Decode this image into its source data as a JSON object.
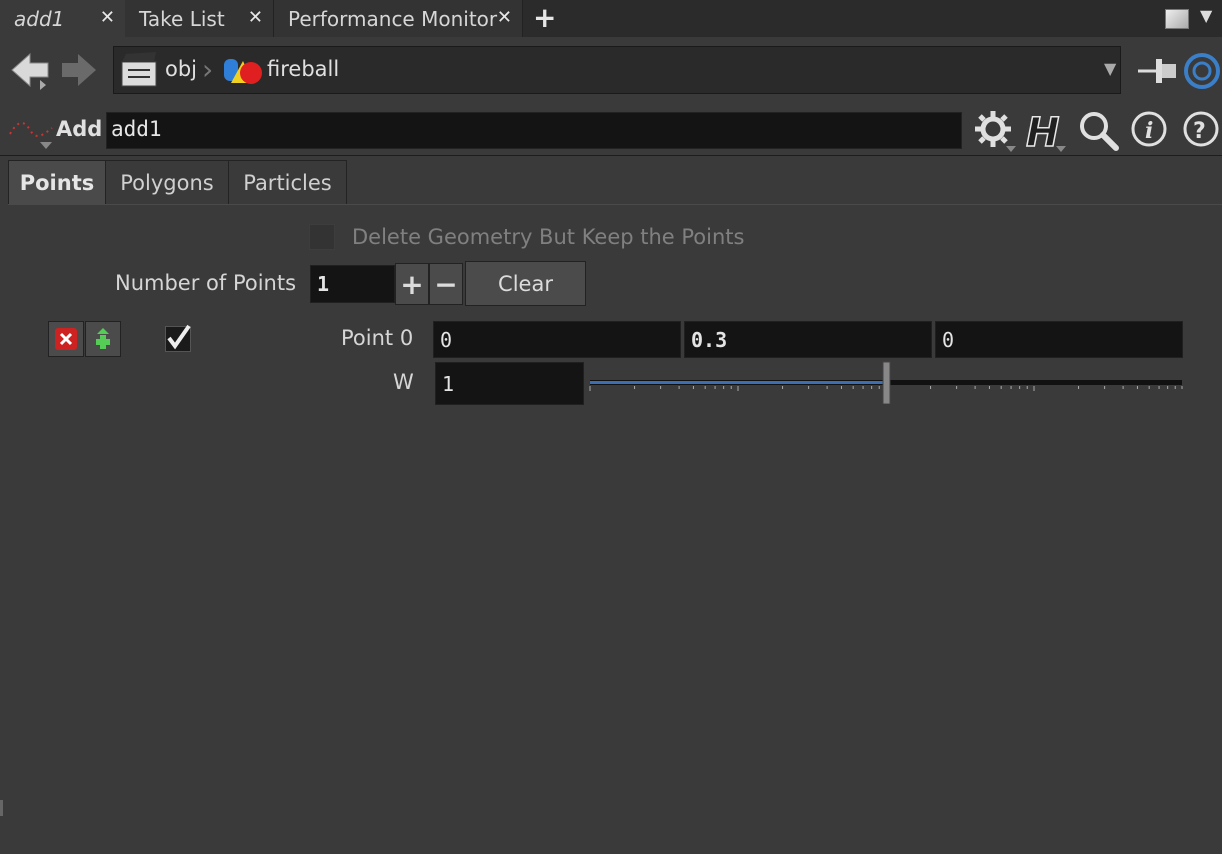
{
  "tabs": [
    {
      "label": "add1",
      "close": "✕"
    },
    {
      "label": "Take List",
      "close": "✕"
    },
    {
      "label": "Performance Monitor",
      "close": "✕"
    }
  ],
  "new_tab": "+",
  "path": {
    "root": "obj",
    "node": "fireball",
    "separator": "›"
  },
  "operator": {
    "type_label": "Add",
    "name": "add1"
  },
  "parm_tabs": [
    "Points",
    "Polygons",
    "Particles"
  ],
  "delete_geometry_label": "Delete Geometry But Keep the Points",
  "number_of_points": {
    "label": "Number of Points",
    "value": "1",
    "plus": "+",
    "minus": "−",
    "clear": "Clear"
  },
  "point0": {
    "label": "Point 0",
    "x": "0",
    "y": "0.3",
    "z": "0"
  },
  "weight": {
    "label": "W",
    "value": "1",
    "slider_fraction": 0.5
  }
}
